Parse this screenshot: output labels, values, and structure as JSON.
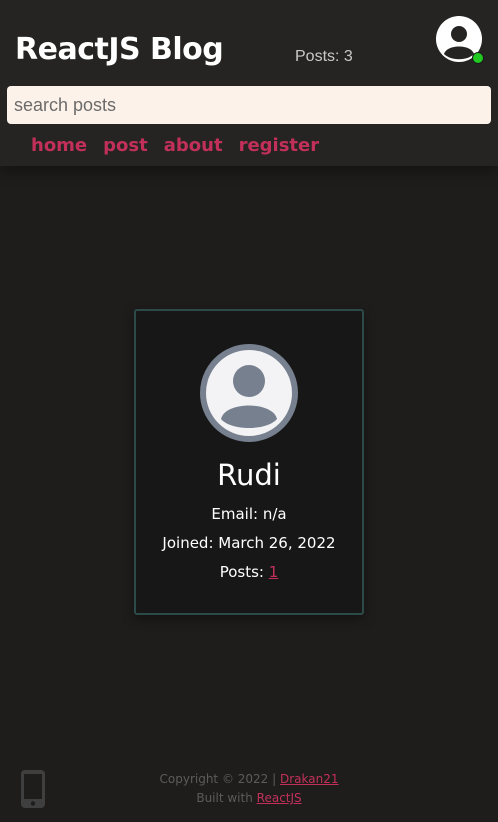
{
  "header": {
    "title": "ReactJS Blog",
    "posts_count": "Posts: 3",
    "avatar_icon": "user-circle-icon",
    "online_status_color": "#22c822"
  },
  "search": {
    "placeholder": "search posts",
    "value": ""
  },
  "nav": {
    "items": [
      {
        "label": "home"
      },
      {
        "label": "post"
      },
      {
        "label": "about"
      },
      {
        "label": "register"
      }
    ]
  },
  "profile": {
    "avatar_icon": "user-circle-icon",
    "name": "Rudi",
    "email_label": "Email: n/a",
    "joined_label": "Joined: March 26, 2022",
    "posts_label": "Posts:",
    "posts_value": "1"
  },
  "footer": {
    "device_icon": "smartphone-icon",
    "copyright": "Copyright © 2022 |",
    "author_link": "Drakan21",
    "built_with": "Built with",
    "framework_link": "ReactJS"
  },
  "colors": {
    "accent": "#c2305a",
    "background": "#1e1d1c",
    "header_background": "#252423",
    "card_border": "#2c4a48"
  }
}
